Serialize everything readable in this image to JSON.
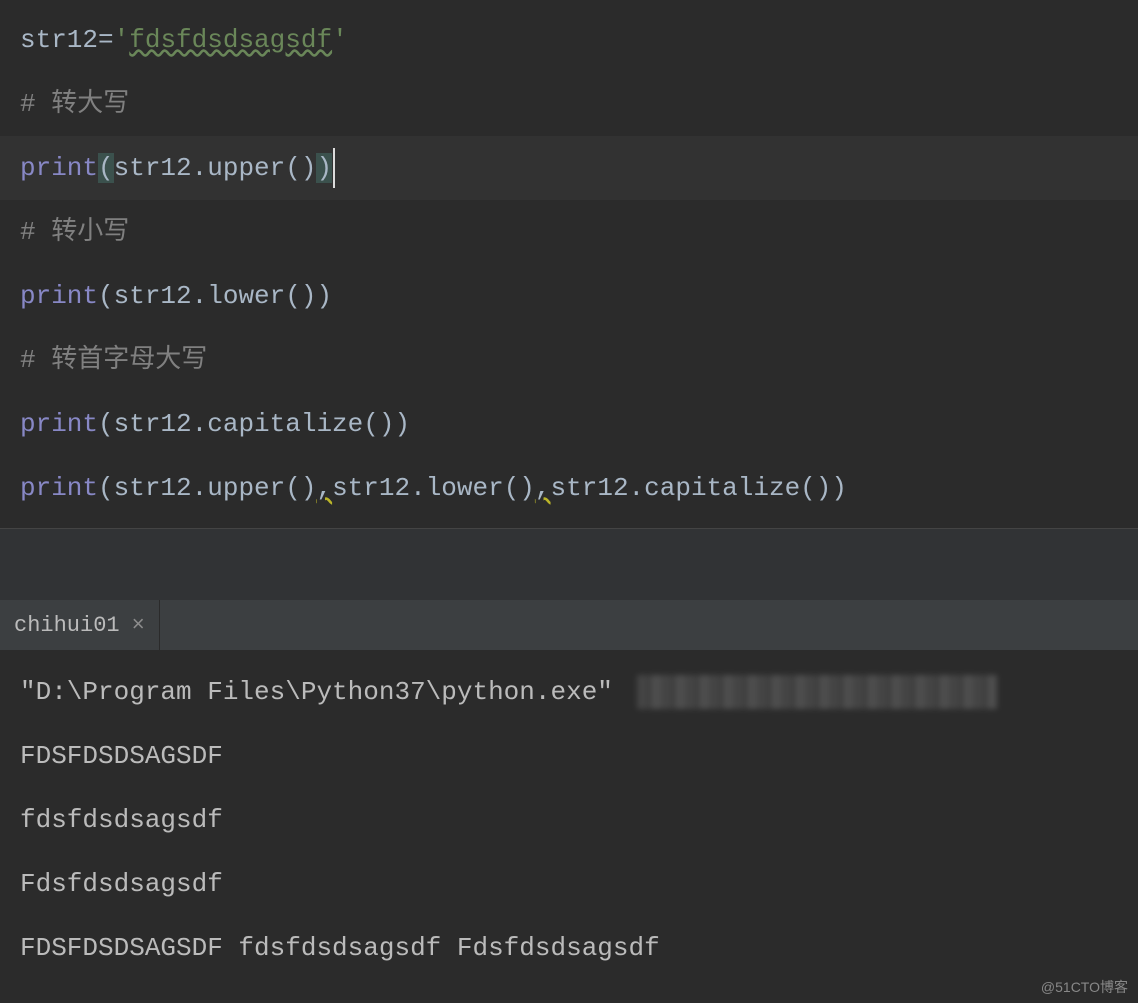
{
  "code": {
    "l1": {
      "varname": "str12",
      "eq": "=",
      "q1": "'",
      "strval": "fdsfdsdsagsdf",
      "q2": "'"
    },
    "l2": "# 转大写",
    "l3": {
      "fn": "print",
      "lp": "(",
      "arg": "str12.upper()",
      "rp": ")"
    },
    "l4": "# 转小写",
    "l5": {
      "fn": "print",
      "lp": "(",
      "arg": "str12.lower()",
      "rp": ")"
    },
    "l6": "# 转首字母大写",
    "l7": {
      "fn": "print",
      "lp": "(",
      "arg": "str12.capitalize()",
      "rp": ")"
    },
    "l8": {
      "fn": "print",
      "lp": "(",
      "a1": "str12.upper()",
      "c1": ",",
      "a2": "str12.lower()",
      "c2": ",",
      "a3": "str12.capitalize()",
      "rp": ")"
    }
  },
  "tab": {
    "label": "chihui01",
    "close": "×"
  },
  "console": {
    "cmd": "\"D:\\Program Files\\Python37\\python.exe\" ",
    "o1": "FDSFDSDSAGSDF",
    "o2": "fdsfdsdsagsdf",
    "o3": "Fdsfdsdsagsdf",
    "o4": "FDSFDSDSAGSDF fdsfdsdsagsdf Fdsfdsdsagsdf"
  },
  "watermark": "@51CTO博客"
}
